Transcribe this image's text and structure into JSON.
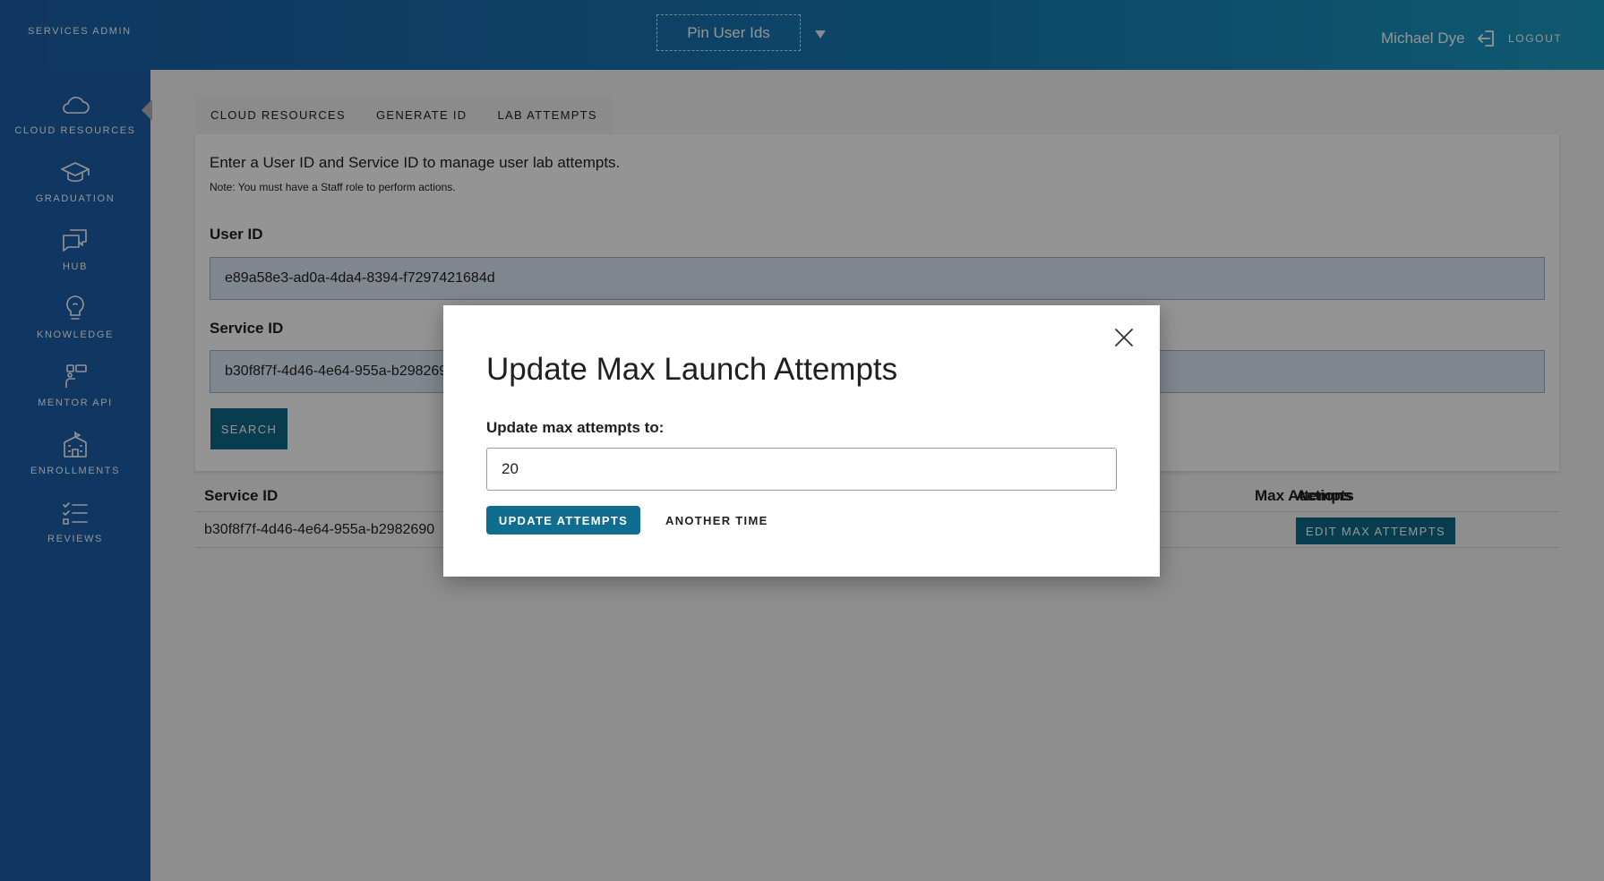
{
  "header": {
    "brand": "SERVICES ADMIN",
    "pin_select": "Pin User Ids",
    "user_name": "Michael Dye",
    "logout_label": "LOGOUT"
  },
  "sidebar": {
    "items": [
      {
        "label": "CLOUD RESOURCES",
        "icon": "cloud-icon"
      },
      {
        "label": "GRADUATION",
        "icon": "graduation-cap-icon"
      },
      {
        "label": "HUB",
        "icon": "chat-bubbles-icon"
      },
      {
        "label": "KNOWLEDGE",
        "icon": "lightbulb-icon"
      },
      {
        "label": "MENTOR API",
        "icon": "mentor-api-icon"
      },
      {
        "label": "ENROLLMENTS",
        "icon": "school-building-icon"
      },
      {
        "label": "REVIEWS",
        "icon": "checklist-icon"
      }
    ]
  },
  "tabs": [
    "CLOUD RESOURCES",
    "GENERATE ID",
    "LAB ATTEMPTS"
  ],
  "form": {
    "intro": "Enter a User ID and Service ID to manage user lab attempts.",
    "note": "Note: You must have a Staff role to perform actions.",
    "user_id_label": "User ID",
    "user_id_value": "e89a58e3-ad0a-4da4-8394-f7297421684d",
    "service_id_label": "Service ID",
    "service_id_value": "b30f8f7f-4d46-4e64-955a-b2982690",
    "search_label": "SEARCH"
  },
  "table": {
    "headers": {
      "service_id": "Service ID",
      "attempts": "Max Attempts",
      "actions": "Actions"
    },
    "rows": [
      {
        "service_id": "b30f8f7f-4d46-4e64-955a-b2982690",
        "action_label": "EDIT MAX ATTEMPTS"
      }
    ]
  },
  "modal": {
    "title": "Update Max Launch Attempts",
    "label": "Update max attempts to:",
    "input_value": "20",
    "update_label": "UPDATE ATTEMPTS",
    "cancel_label": "ANOTHER TIME"
  },
  "colors": {
    "header_start": "#1a5fa8",
    "header_end": "#1a9ac2",
    "sidebar": "#1a5fa8",
    "primary_button": "#0d6a88"
  }
}
